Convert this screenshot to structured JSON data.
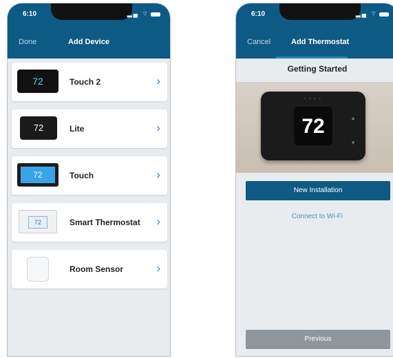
{
  "left_phone": {
    "status_time": "6:10",
    "nav_left": "Done",
    "nav_title": "Add Device",
    "devices": [
      {
        "name": "Touch 2",
        "thumb_text": "72"
      },
      {
        "name": "Lite",
        "thumb_text": "72"
      },
      {
        "name": "Touch",
        "thumb_text": "72"
      },
      {
        "name": "Smart Thermostat",
        "thumb_text": "72"
      },
      {
        "name": "Room Sensor",
        "thumb_text": ""
      }
    ]
  },
  "right_phone": {
    "status_time": "6:10",
    "nav_left": "Cancel",
    "nav_title": "Add Thermostat",
    "heading": "Getting Started",
    "device_temp": "72",
    "new_installation_label": "New Installation",
    "connect_label": "Connect to Wi-Fi",
    "previous_label": "Previous"
  }
}
